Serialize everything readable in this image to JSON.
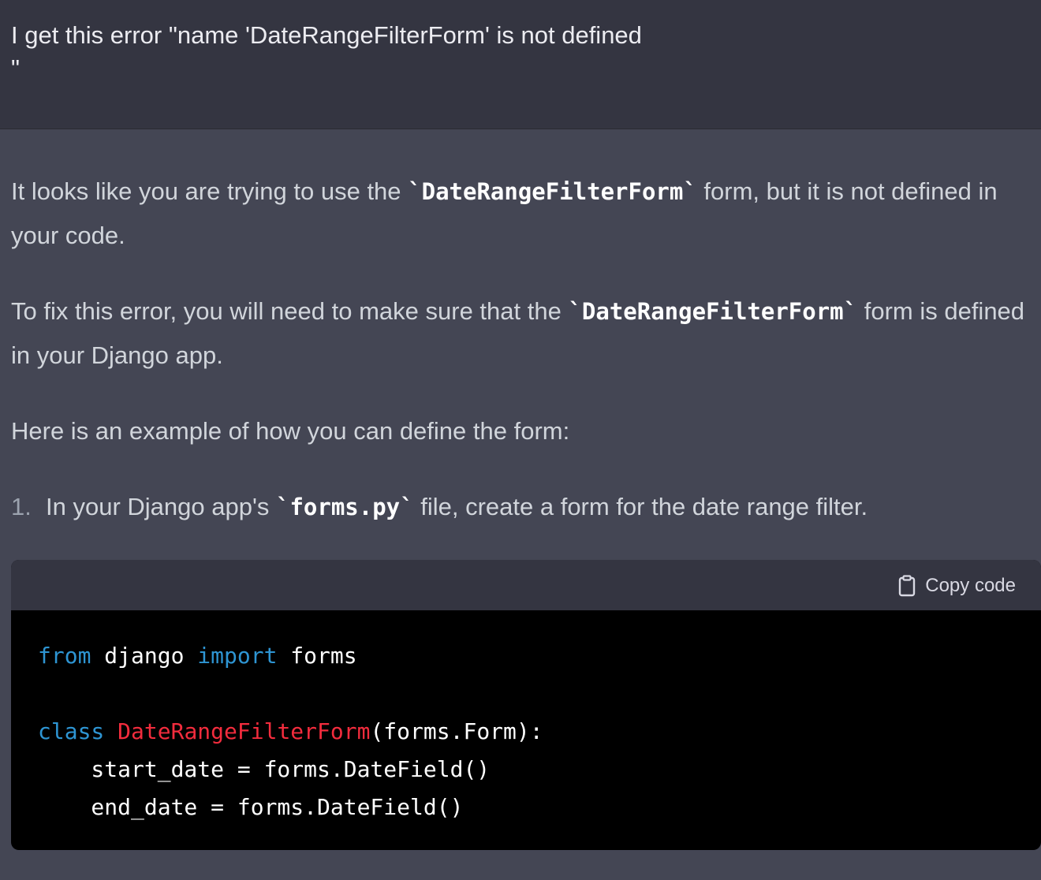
{
  "user_message": {
    "text": "I get this error \"name 'DateRangeFilterForm' is not defined\n\""
  },
  "assistant": {
    "p1": {
      "before": "It looks like you are trying to use the ",
      "code": "`DateRangeFilterForm`",
      "after": " form, but it is not defined in your code."
    },
    "p2": {
      "before": "To fix this error, you will need to make sure that the ",
      "code": "`DateRangeFilterForm`",
      "after": " form is defined in your Django app."
    },
    "p3": "Here is an example of how you can define the form:",
    "list_item": {
      "number": "1.",
      "before": "In your Django app's ",
      "code": "`forms.py`",
      "after": " file, create a form for the date range filter."
    }
  },
  "code_block": {
    "copy_label": "Copy code",
    "copy_icon": "clipboard-icon",
    "lines": {
      "l1_kw1": "from",
      "l1_mod": " django ",
      "l1_kw2": "import",
      "l1_rest": " forms",
      "l3_kw": "class",
      "l3_sp": " ",
      "l3_cls": "DateRangeFilterForm",
      "l3_rest": "(forms.Form):",
      "l4": "    start_date = forms.DateField()",
      "l5": "    end_date = forms.DateField()"
    }
  },
  "colors": {
    "user_bg": "#343541",
    "assistant_bg": "#444654",
    "code_bg": "#000000",
    "keyword": "#2e95d3",
    "class_name": "#f22c3d"
  }
}
